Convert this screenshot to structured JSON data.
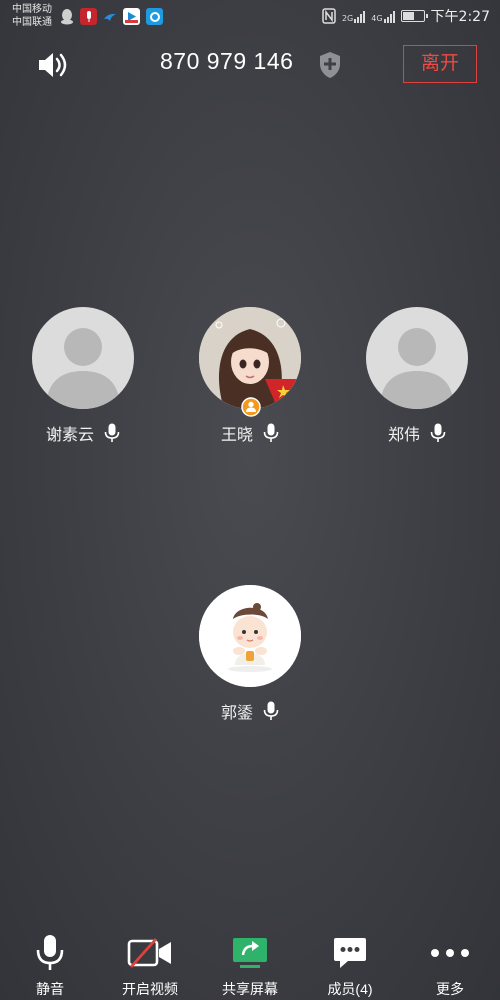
{
  "status_bar": {
    "carrier1": "中国移动",
    "carrier2": "中国联通",
    "net1": "2G",
    "net2": "4G",
    "time": "下午2:27"
  },
  "header": {
    "meeting_id": "870 979 146",
    "leave_label": "离开"
  },
  "participants": [
    {
      "name": "谢素云",
      "avatar": "default"
    },
    {
      "name": "王晓",
      "avatar": "girl-photo",
      "host_badge": true
    },
    {
      "name": "郑伟",
      "avatar": "default"
    },
    {
      "name": "郭鋈",
      "avatar": "baby-cartoon"
    }
  ],
  "toolbar": [
    {
      "label": "静音",
      "icon": "mic-icon"
    },
    {
      "label": "开启视频",
      "icon": "video-off-icon"
    },
    {
      "label": "共享屏幕",
      "icon": "share-screen-icon",
      "color": "#2fb36a"
    },
    {
      "label": "成员(4)",
      "icon": "chat-members-icon"
    },
    {
      "label": "更多",
      "icon": "more-icon"
    }
  ],
  "colors": {
    "leave": "#e0413c",
    "host_badge": "#f39a1e",
    "share": "#2fb36a"
  }
}
